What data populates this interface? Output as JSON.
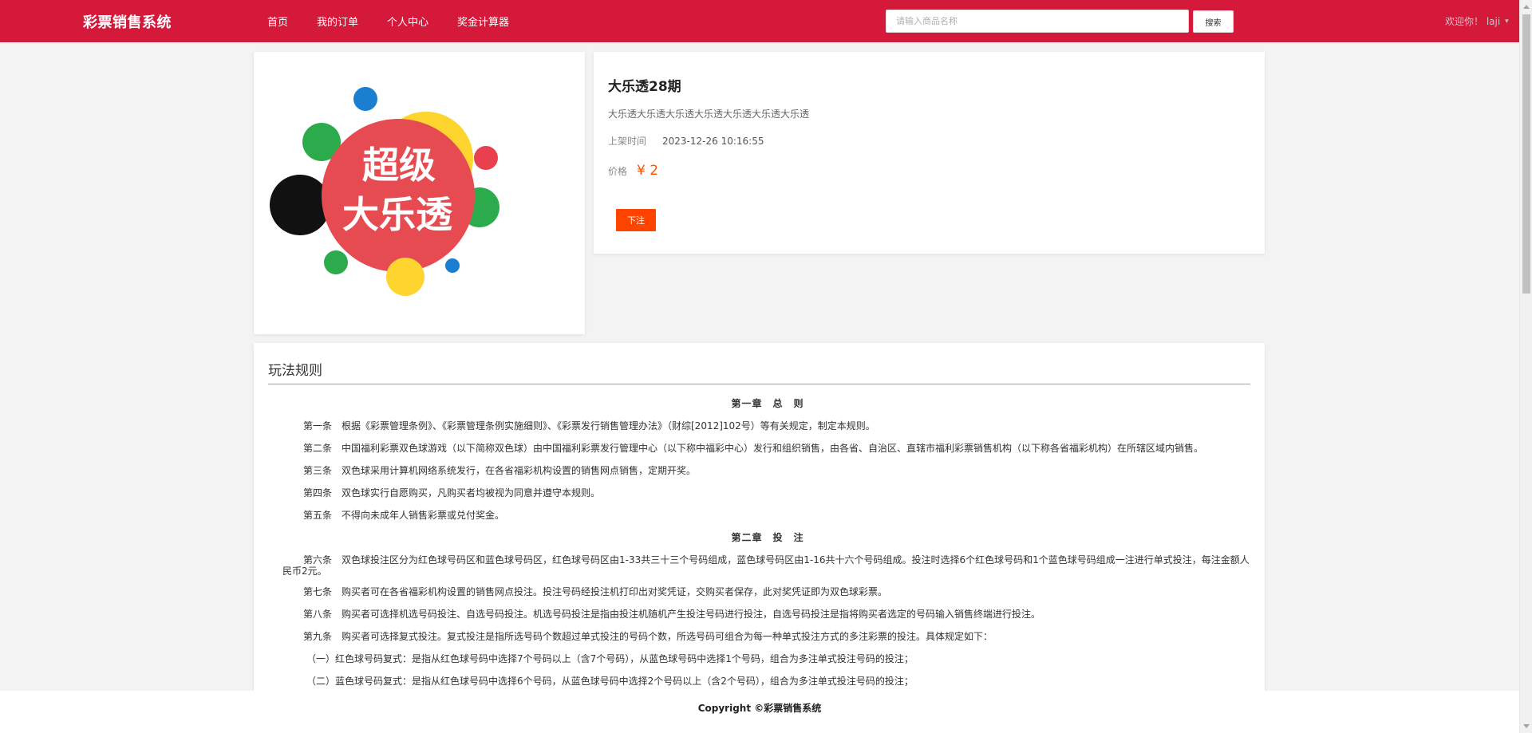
{
  "header": {
    "brand": "彩票销售系统",
    "nav": [
      "首页",
      "我的订单",
      "个人中心",
      "奖金计算器"
    ],
    "search_placeholder": "请输入商品名称",
    "search_button": "搜索",
    "welcome": "欢迎你！ laji"
  },
  "product": {
    "logo_text_line1": "超级",
    "logo_text_line2": "大乐透",
    "title": "大乐透28期",
    "description": "大乐透大乐透大乐透大乐透大乐透大乐透大乐透",
    "listed_label": "上架时间",
    "listed_time": "2023-12-26 10:16:55",
    "price_label": "价格",
    "price": "¥ 2",
    "order_button": "下注"
  },
  "rules": {
    "title": "玩法规则",
    "chapter1": "第一章　总　则",
    "p1": "第一条　根据《彩票管理条例》、《彩票管理条例实施细则》、《彩票发行销售管理办法》（财综[2012]102号）等有关规定，制定本规则。",
    "p2": "第二条　中国福利彩票双色球游戏（以下简称双色球）由中国福利彩票发行管理中心（以下称中福彩中心）发行和组织销售，由各省、自治区、直辖市福利彩票销售机构（以下称各省福彩机构）在所辖区域内销售。",
    "p3": "第三条　双色球采用计算机网络系统发行，在各省福彩机构设置的销售网点销售，定期开奖。",
    "p4": "第四条　双色球实行自愿购买，凡购买者均被视为同意并遵守本规则。",
    "p5": "第五条　不得向未成年人销售彩票或兑付奖金。",
    "chapter2": "第二章　投　注",
    "p6": "第六条　双色球投注区分为红色球号码区和蓝色球号码区，红色球号码区由1-33共三十三个号码组成，蓝色球号码区由1-16共十六个号码组成。投注时选择6个红色球号码和1个蓝色球号码组成一注进行单式投注，每注金额人民币2元。",
    "p7": "第七条　购买者可在各省福彩机构设置的销售网点投注。投注号码经投注机打印出对奖凭证，交购买者保存，此对奖凭证即为双色球彩票。",
    "p8": "第八条　购买者可选择机选号码投注、自选号码投注。机选号码投注是指由投注机随机产生投注号码进行投注，自选号码投注是指将购买者选定的号码输入销售终端进行投注。",
    "p9": "第九条　购买者可选择复式投注。复式投注是指所选号码个数超过单式投注的号码个数，所选号码可组合为每一种单式投注方式的多注彩票的投注。具体规定如下：",
    "s1": "（一）红色球号码复式：是指从红色球号码中选择7个号码以上（含7个号码），从蓝色球号码中选择1个号码，组合为多注单式投注号码的投注；",
    "s2": "（二）蓝色球号码复式：是指从红色球号码中选择6个号码，从蓝色球号码中选择2个号码以上（含2个号码），组合为多注单式投注号码的投注；"
  },
  "footer": "Copyright ©彩票销售系统",
  "colors": {
    "primary": "#d5193b",
    "accent": "#ff4400",
    "price": "#ff5000",
    "divider": "#d99a3a"
  }
}
